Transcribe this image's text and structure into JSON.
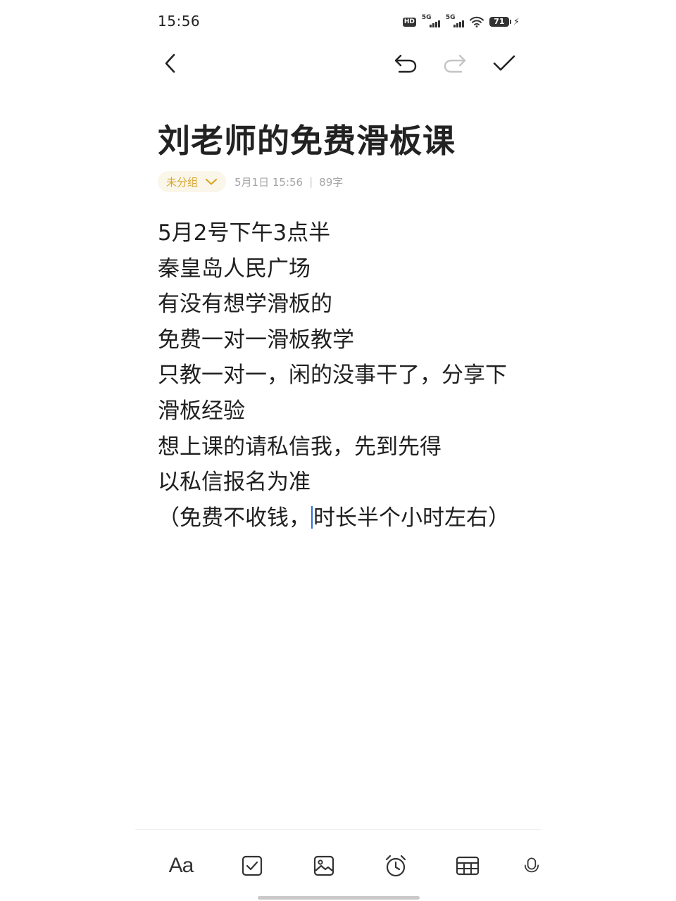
{
  "status_bar": {
    "time": "15:56",
    "hd_label": "HD",
    "signal_1_label": "5G",
    "signal_2_label": "5G",
    "battery": "71"
  },
  "toolbar": {
    "back_icon": "chevron-left-icon",
    "undo_icon": "undo-icon",
    "redo_icon": "redo-icon",
    "done_icon": "check-icon"
  },
  "note": {
    "title": "刘老师的免费滑板课",
    "group_label": "未分组",
    "date": "5月1日 15:56",
    "separator": "|",
    "word_count": "89字",
    "lines": [
      "5月2号下午3点半",
      "秦皇岛人民广场",
      "有没有想学滑板的",
      "免费一对一滑板教学",
      "只教一对一，闲的没事干了，分享下",
      "滑板经验",
      "想上课的请私信我，先到先得",
      "以私信报名为准"
    ],
    "last_line_before_cursor": "（免费不收钱，",
    "last_line_after_cursor": "时长半个小时左右）"
  },
  "bottom_bar": {
    "text_style_label": "Aa",
    "icons": [
      "text-style-icon",
      "checklist-icon",
      "image-icon",
      "alarm-icon",
      "table-icon",
      "microphone-icon"
    ]
  },
  "colors": {
    "accent": "#d6a62a",
    "chip_background": "#fbf6ea",
    "cursor": "#2f6fdf",
    "meta_text": "#a5a5a5"
  }
}
